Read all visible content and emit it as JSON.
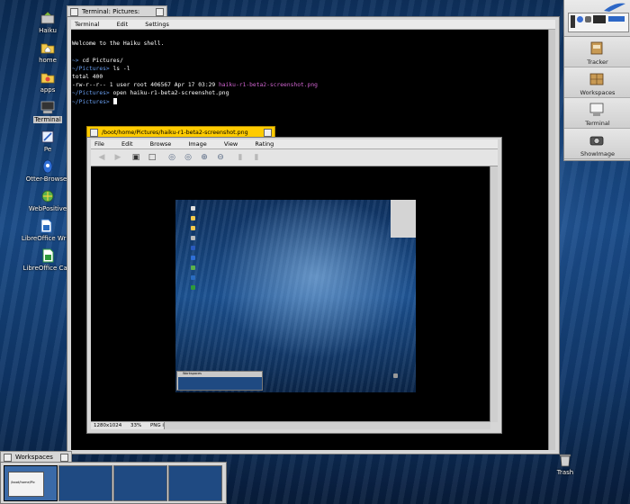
{
  "desktop": {
    "icons": [
      {
        "label": "Haiku",
        "icon": "haiku-volume-icon"
      },
      {
        "label": "home",
        "icon": "home-folder-icon"
      },
      {
        "label": "apps",
        "icon": "apps-folder-icon"
      },
      {
        "label": "Terminal",
        "icon": "terminal-icon"
      },
      {
        "label": "Pe",
        "icon": "pe-editor-icon"
      },
      {
        "label": "Otter-Browser",
        "icon": "otter-browser-icon"
      },
      {
        "label": "WebPositive",
        "icon": "webpositive-icon"
      },
      {
        "label": "LibreOffice Writ",
        "icon": "libreoffice-writer-icon"
      },
      {
        "label": "LibreOffice Calc",
        "icon": "libreoffice-calc-icon"
      }
    ],
    "trash_label": "Trash"
  },
  "deskbar": {
    "items": [
      {
        "label": "Tracker",
        "icon": "tracker-icon"
      },
      {
        "label": "Workspaces",
        "icon": "workspaces-icon"
      },
      {
        "label": "Terminal",
        "icon": "terminal-icon"
      },
      {
        "label": "ShowImage",
        "icon": "showimage-icon"
      }
    ]
  },
  "terminal": {
    "title": "Terminal: Pictures: ~",
    "menus": [
      "Terminal",
      "Edit",
      "Settings"
    ],
    "lines": {
      "l1": "Welcome to the Haiku shell.",
      "l2_prompt": "~>",
      "l2_cmd": " cd Pictures/",
      "l3_prompt": "~/Pictures>",
      "l3_cmd": " ls -l",
      "l4": "total 400",
      "l5_attrs": "-rw-r--r-- 1 user root 406567 Apr 17 03:29 ",
      "l5_file": "haiku-r1-beta2-screenshot.png",
      "l6_prompt": "~/Pictures>",
      "l6_cmd": " open haiku-r1-beta2-screenshot.png",
      "l7_prompt": "~/Pictures>"
    }
  },
  "showimage": {
    "title": "/boot/home/Pictures/haiku-r1-beta2-screenshot.png",
    "menus": [
      "File",
      "Edit",
      "Browse",
      "Image",
      "View",
      "Rating"
    ],
    "status": {
      "resolution": "1280x1024",
      "zoom": "33%",
      "type": "PNG image"
    },
    "inner_workspace_label": "Workspaces"
  },
  "workspaces": {
    "title": "Workspaces",
    "inner_window_label": "/boot/home/Pic"
  },
  "colors": {
    "active_tab": "#ffcb00",
    "prompt": "#6a9ff0",
    "filename": "#d064d0"
  }
}
